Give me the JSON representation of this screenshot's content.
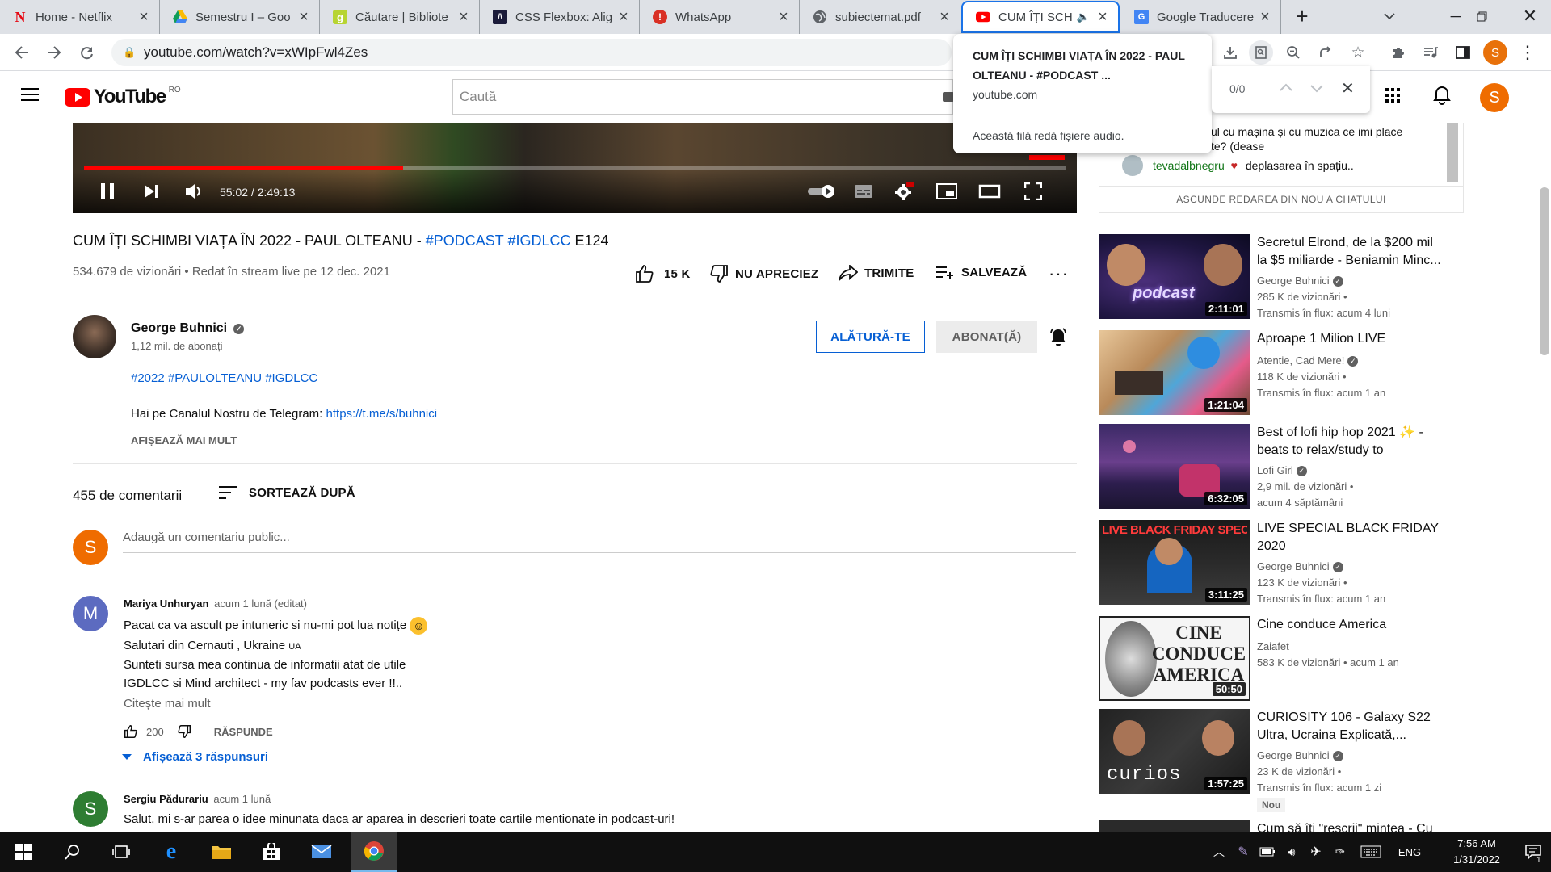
{
  "tabs": [
    {
      "title": "Home - Netflix",
      "icon": "netflix-icon"
    },
    {
      "title": "Semestru I – Goo",
      "icon": "google-drive-icon"
    },
    {
      "title": "Căutare | Bibliote",
      "icon": "goodreads-icon"
    },
    {
      "title": "CSS Flexbox: Alig",
      "icon": "codepen-icon"
    },
    {
      "title": "WhatsApp",
      "icon": "alert-icon"
    },
    {
      "title": "subiectemat.pdf",
      "icon": "globe-icon"
    },
    {
      "title": "CUM ÎȚI SCH",
      "icon": "youtube-icon"
    },
    {
      "title": "Google Traducere",
      "icon": "google-translate-icon"
    }
  ],
  "toolbar": {
    "url": "youtube.com/watch?v=xWIpFwl4Zes"
  },
  "tooltip": {
    "title": "CUM ÎȚI SCHIMBI VIAȚA ÎN 2022 - PAUL OLTEANU - #PODCAST ...",
    "domain": "youtube.com",
    "audio_note": "Această filă redă fișiere audio."
  },
  "find": {
    "count": "0/0"
  },
  "header": {
    "logo": "YouTube",
    "region": "RO",
    "search_placeholder": "Caută",
    "avatar": "S"
  },
  "player": {
    "time": "55:02 / 2:49:13",
    "progress_fraction": 0.325
  },
  "video": {
    "title_prefix": "CUM ÎȚI SCHIMBI VIAȚA ÎN 2022 - PAUL OLTEANU - ",
    "tag1": "#PODCAST",
    "tag2": "#IGDLCC",
    "title_suffix": " E124",
    "views": "534.679 de vizionări • Redat în stream live pe 12 dec. 2021",
    "like": "15 K",
    "dislike": "NU APRECIEZ",
    "share": "TRIMITE",
    "save": "SALVEAZĂ"
  },
  "channel": {
    "name": "George Buhnici",
    "subs": "1,12 mil. de abonați",
    "join": "ALĂTURĂ-TE",
    "subscribed": "ABONAT(Ă)"
  },
  "description": {
    "hashtags": "#2022 #PAULOLTEANU #IGDLCC",
    "telegram_text": "Hai pe Canalul Nostru de Telegram: ",
    "telegram_link": "https://t.me/s/buhnici",
    "more": "AFIȘEAZĂ MAI MULT"
  },
  "comments": {
    "count": "455 de comentarii",
    "sort": "SORTEAZĂ DUPĂ",
    "add_placeholder": "Adaugă un comentariu public...",
    "user_avatar": "S",
    "items": [
      {
        "avatar": "M",
        "author": "Mariya Unhuryan",
        "meta": "acum 1 lună (editat)",
        "lines": [
          "Pacat ca va ascult pe intuneric si nu-mi pot lua notițe",
          "Salutari din Cernauti , Ukraine",
          "Sunteti sursa mea continua de informatii atat de utile",
          "IGDLCC si Mind architect -  my fav podcasts ever !!.."
        ],
        "flag": "UA",
        "read_more": "Citește mai mult",
        "likes": "200",
        "reply": "RĂSPUNDE",
        "replies": "Afișează 3 răspunsuri"
      },
      {
        "avatar": "S",
        "author": "Sergiu Pădurariu",
        "meta": "acum 1 lună",
        "lines": [
          "Salut, mi s-ar parea o idee minunata daca ar aparea in descrieri toate cartile mentionate in podcast-uri!"
        ]
      }
    ]
  },
  "chat": {
    "line1": "ul cu mașina și cu muzica ce imi place",
    "line2": "te? (dease",
    "user": "tevadalbnegru",
    "msg": "deplasarea în spațiu..",
    "hide": "ASCUNDE REDAREA DIN NOU A CHATULUI"
  },
  "recommendations": [
    {
      "title": "Secretul Elrond, de la $200 mil la $5 miliarde - Beniamin Minc...",
      "channel": "George Buhnici",
      "verified": true,
      "views": "285 K de vizionări",
      "age": "Transmis în flux: acum 4 luni",
      "duration": "2:11:01",
      "thumb_text": "podcast"
    },
    {
      "title": "Aproape 1 Milion LIVE",
      "channel": "Atentie, Cad Mere!",
      "verified": true,
      "views": "118 K de vizionări",
      "age": "Transmis în flux: acum 1 an",
      "duration": "1:21:04",
      "thumb_text": ""
    },
    {
      "title": "Best of lofi hip hop 2021 ✨ - beats to relax/study to",
      "channel": "Lofi Girl",
      "verified": true,
      "views": "2,9 mil. de vizionări",
      "age": "acum 4 săptămâni",
      "duration": "6:32:05",
      "thumb_text": ""
    },
    {
      "title": "LIVE SPECIAL BLACK FRIDAY 2020",
      "channel": "George Buhnici",
      "verified": true,
      "views": "123 K de vizionări",
      "age": "Transmis în flux: acum 1 an",
      "duration": "3:11:25",
      "thumb_text": "LIVE BLACK FRIDAY SPECIAL"
    },
    {
      "title": "Cine conduce America",
      "channel": "Zaiafet",
      "verified": false,
      "views": "583 K de vizionări",
      "age": "acum 1 an",
      "duration": "50:50",
      "thumb_text": "CINE CONDUCE AMERICA"
    },
    {
      "title": "CURIOSITY 106 - Galaxy S22 Ultra, Ucraina Explicată,...",
      "channel": "George Buhnici",
      "verified": true,
      "views": "23 K de vizionări",
      "age": "Transmis în flux: acum 1 zi",
      "duration": "1:57:25",
      "thumb_text": "curios",
      "badge": "Nou"
    },
    {
      "title": "Cum să îți \"rescrii\" mintea - Cu",
      "channel": "",
      "verified": false,
      "views": "",
      "age": "",
      "duration": "",
      "thumb_text": ""
    }
  ],
  "taskbar": {
    "time": "7:56 AM",
    "date": "1/31/2022",
    "lang": "ENG",
    "notif_count": "1"
  }
}
